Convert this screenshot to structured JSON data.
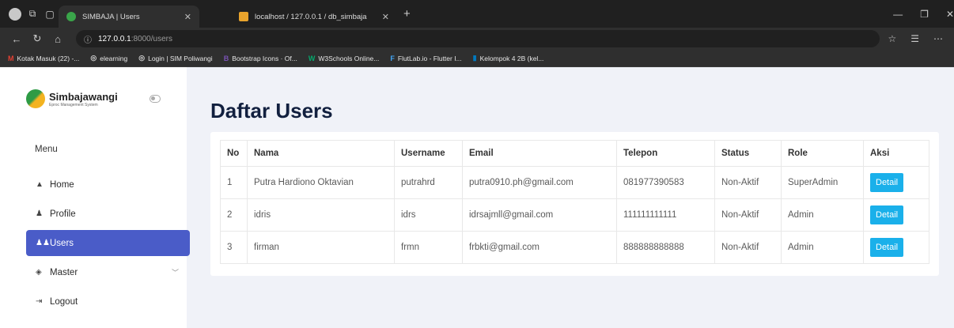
{
  "browser": {
    "tabs": [
      {
        "title": "SIMBAJA | Users",
        "active": true,
        "favicon_color": "#3aa54a"
      },
      {
        "title": "localhost / 127.0.0.1 / db_simbaja",
        "active": false,
        "favicon_color": "#e8a32c"
      }
    ],
    "url_host": "127.0.0.1",
    "url_path": ":8000/users",
    "bookmarks": [
      {
        "label": "Kotak Masuk (22) -...",
        "icon": "M",
        "color": "#e34133"
      },
      {
        "label": "elearning",
        "icon": "◎",
        "color": "#cccccc"
      },
      {
        "label": "Login | SIM Poliwangi",
        "icon": "◎",
        "color": "#cccccc"
      },
      {
        "label": "Bootstrap Icons · Of...",
        "icon": "B",
        "color": "#7952b3"
      },
      {
        "label": "W3Schools Online...",
        "icon": "W",
        "color": "#04aa6d"
      },
      {
        "label": "FlutLab.io - Flutter I...",
        "icon": "F",
        "color": "#42a5f5"
      },
      {
        "label": "Kelompok 4 2B (kel...",
        "icon": "▮",
        "color": "#0079bf"
      }
    ]
  },
  "sidebar": {
    "brand_name": "Simbajawangi",
    "brand_sub": "Eproc Management System",
    "menu_heading": "Menu",
    "items": [
      {
        "label": "Home",
        "icon": "home-icon",
        "glyph": "🏠"
      },
      {
        "label": "Profile",
        "icon": "person-icon",
        "glyph": "👤"
      },
      {
        "label": "Users",
        "icon": "people-icon",
        "glyph": "👥"
      },
      {
        "label": "Master",
        "icon": "layers-icon",
        "glyph": "◈"
      },
      {
        "label": "Logout",
        "icon": "logout-icon",
        "glyph": "⇥"
      }
    ]
  },
  "main": {
    "title": "Daftar Users",
    "columns": [
      "No",
      "Nama",
      "Username",
      "Email",
      "Telepon",
      "Status",
      "Role",
      "Aksi"
    ],
    "rows": [
      {
        "no": "1",
        "nama": "Putra Hardiono Oktavian",
        "username": "putrahrd",
        "email": "putra0910.ph@gmail.com",
        "telepon": "081977390583",
        "status": "Non-Aktif",
        "role": "SuperAdmin",
        "aksi": "Detail"
      },
      {
        "no": "2",
        "nama": "idris",
        "username": "idrs",
        "email": "idrsajmll@gmail.com",
        "telepon": "111111111111",
        "status": "Non-Aktif",
        "role": "Admin",
        "aksi": "Detail"
      },
      {
        "no": "3",
        "nama": "firman",
        "username": "frmn",
        "email": "frbkti@gmail.com",
        "telepon": "888888888888",
        "status": "Non-Aktif",
        "role": "Admin",
        "aksi": "Detail"
      }
    ]
  },
  "colors": {
    "accent": "#4a5cc8",
    "detail_button": "#1ab0ea",
    "title": "#12203f"
  }
}
